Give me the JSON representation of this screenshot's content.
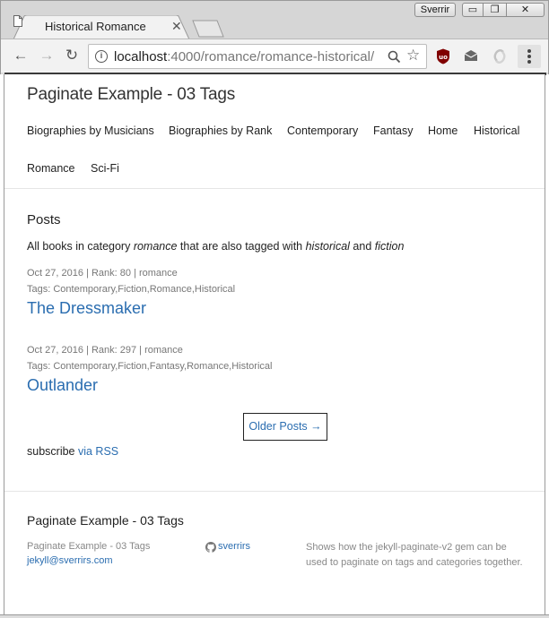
{
  "browser": {
    "tab_title": "Historical Romance",
    "tab_close": "✕",
    "profile_name": "Sverrir",
    "url_host": "localhost",
    "url_rest": ":4000/romance/romance-historical/",
    "window_min": "▭",
    "window_max": "❐",
    "window_close": "✕"
  },
  "site": {
    "title": "Paginate Example - 03 Tags",
    "nav": [
      "Biographies by Musicians",
      "Biographies by Rank",
      "Contemporary",
      "Fantasy",
      "Home",
      "Historical",
      "Romance",
      "Sci-Fi"
    ]
  },
  "main": {
    "heading": "Posts",
    "intro_prefix": "All books in category ",
    "intro_category": "romance",
    "intro_middle": " that are also tagged with ",
    "intro_tag1": "historical",
    "intro_and": " and ",
    "intro_tag2": "fiction",
    "posts": [
      {
        "meta": "Oct 27, 2016 | Rank: 80 | romance",
        "tags": "Tags: Contemporary,Fiction,Romance,Historical",
        "title": "The Dressmaker"
      },
      {
        "meta": "Oct 27, 2016 | Rank: 297 | romance",
        "tags": "Tags: Contemporary,Fiction,Fantasy,Romance,Historical",
        "title": "Outlander"
      }
    ],
    "older_posts": "Older Posts →",
    "subscribe_prefix": "subscribe ",
    "subscribe_link": "via RSS"
  },
  "footer": {
    "title": "Paginate Example - 03 Tags",
    "site_name": "Paginate Example - 03 Tags",
    "email": "jekyll@sverrirs.com",
    "github_user": "sverrirs",
    "description": "Shows how the jekyll-paginate-v2 gem can be used to paginate on tags and categories together."
  },
  "colors": {
    "link": "#2a6db0",
    "text": "#222222",
    "muted": "#777777"
  }
}
